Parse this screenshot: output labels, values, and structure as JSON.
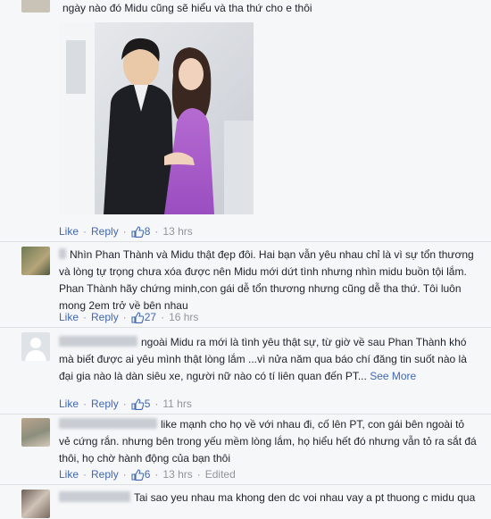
{
  "colors": {
    "link": "#4267b2",
    "meta": "#90949c",
    "text": "#1d2129",
    "background": "#f6f7f9"
  },
  "comments": [
    {
      "text": "ngày nào đó Midu cũng sẽ hiểu và tha thứ cho e thôi",
      "actions": {
        "like": "Like",
        "reply": "Reply",
        "likes": "8",
        "time": "13 hrs"
      }
    },
    {
      "text": "Nhìn Phan Thành và Midu thật đẹp đôi. Hai bạn vẫn yêu nhau chỉ là vì sự tổn thương và lòng tự trọng chưa xóa được nên Midu mới dứt tình nhưng nhìn midu buồn tội lắm. Phan Thành hãy chứng minh,con gái dễ tổn thương nhưng cũng dễ tha thứ. Tôi luôn mong 2em trở về bên nhau",
      "actions": {
        "like": "Like",
        "reply": "Reply",
        "likes": "27",
        "time": "16 hrs"
      }
    },
    {
      "text": "ngoài Midu ra mới là tình yêu thật sự, từ giờ về sau Phan Thành khó mà biết được ai yêu mình thật lòng lắm ...vì nửa năm qua báo chí đăng tin suốt nào là đại gia nào là dàn siêu xe, người nữ nào có tí liên quan đến PT...",
      "see_more": "See More",
      "actions": {
        "like": "Like",
        "reply": "Reply",
        "likes": "5",
        "time": "11 hrs"
      }
    },
    {
      "text": "like mạnh cho họ về với nhau đi, cố lên PT, con gái bên ngoài tỏ vẻ cứng rắn. nhưng bên trong yếu mềm lòng lắm, họ hiểu hết đó nhưng vẫn tỏ ra sắt đá thôi, họ chờ hành động của bạn thôi",
      "actions": {
        "like": "Like",
        "reply": "Reply",
        "likes": "6",
        "time": "13 hrs",
        "edited": "Edited"
      }
    },
    {
      "text": "Tai sao yeu nhau ma khong den dc voi nhau vay a pt thuong c midu qua"
    }
  ]
}
